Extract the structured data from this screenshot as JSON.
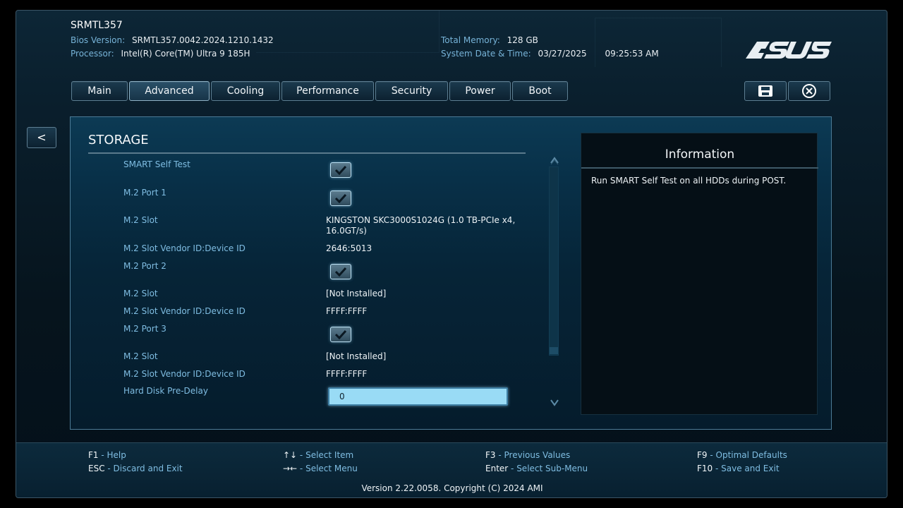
{
  "header": {
    "system_name": "SRMTL357",
    "bios_version_label": "Bios Version:",
    "bios_version_value": "SRMTL357.0042.2024.1210.1432",
    "processor_label": "Processor:",
    "processor_value": "Intel(R) Core(TM) Ultra 9 185H",
    "total_memory_label": "Total Memory:",
    "total_memory_value": "128 GB",
    "date_time_label": "System Date & Time:",
    "date_value": "03/27/2025",
    "time_value": "09:25:53 AM",
    "logo": "ASUS"
  },
  "tabs": [
    {
      "label": "Main"
    },
    {
      "label": "Advanced"
    },
    {
      "label": "Cooling"
    },
    {
      "label": "Performance"
    },
    {
      "label": "Security"
    },
    {
      "label": "Power"
    },
    {
      "label": "Boot"
    }
  ],
  "active_tab": "Advanced",
  "toolbar": {
    "save_icon": "save-icon",
    "exit_icon": "close-circle-icon"
  },
  "back_label": "<",
  "storage": {
    "title": "STORAGE",
    "rows": [
      {
        "label": "SMART Self Test",
        "type": "checkbox",
        "checked": true
      },
      {
        "label": "M.2 Port 1",
        "type": "checkbox",
        "checked": true
      },
      {
        "label": "M.2 Slot",
        "type": "text",
        "value": "KINGSTON SKC3000S1024G (1.0 TB-PCIe x4, 16.0GT/s)"
      },
      {
        "label": "M.2 Slot Vendor ID:Device ID",
        "type": "text",
        "value": "2646:5013"
      },
      {
        "label": "M.2 Port 2",
        "type": "checkbox",
        "checked": true
      },
      {
        "label": "M.2 Slot",
        "type": "text",
        "value": "[Not Installed]"
      },
      {
        "label": "M.2 Slot Vendor ID:Device ID",
        "type": "text",
        "value": "FFFF:FFFF"
      },
      {
        "label": "M.2 Port 3",
        "type": "checkbox",
        "checked": true
      },
      {
        "label": "M.2 Slot",
        "type": "text",
        "value": "[Not Installed]"
      },
      {
        "label": "M.2 Slot Vendor ID:Device ID",
        "type": "text",
        "value": "FFFF:FFFF"
      },
      {
        "label": "Hard Disk Pre-Delay",
        "type": "input",
        "value": "0"
      }
    ]
  },
  "information": {
    "title": "Information",
    "text": "Run SMART Self Test on all HDDs during POST."
  },
  "footer": {
    "keys": [
      {
        "key": "F1",
        "desc": "Help"
      },
      {
        "key": "ESC",
        "desc": "Discard and Exit"
      },
      {
        "key": "↑↓",
        "desc": "Select Item"
      },
      {
        "key": "→←",
        "desc": "Select Menu"
      },
      {
        "key": "F3",
        "desc": "Previous Values"
      },
      {
        "key": "Enter",
        "desc": "Select Sub-Menu"
      },
      {
        "key": "F9",
        "desc": "Optimal Defaults"
      },
      {
        "key": "F10",
        "desc": "Save and Exit"
      }
    ],
    "separator": " - ",
    "version": "Version 2.22.0058. Copyright (C) 2024 AMI"
  },
  "colors": {
    "label_blue": "#7fbde2",
    "panel_border": "#4c7b96",
    "input_bg": "#99dbf5"
  }
}
